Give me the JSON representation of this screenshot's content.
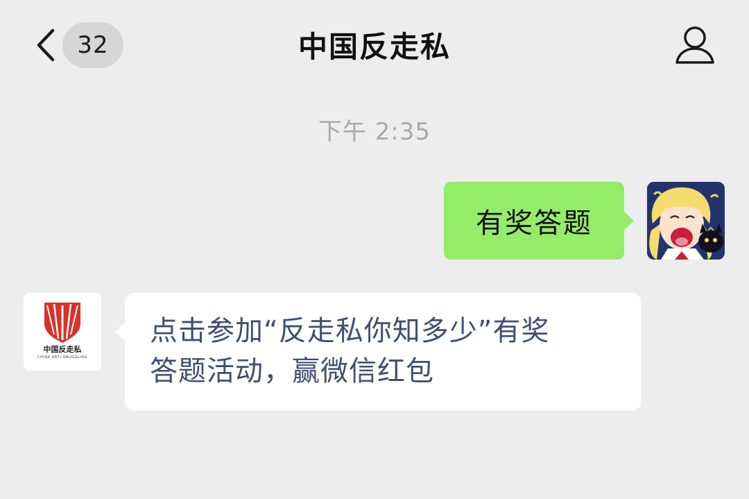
{
  "header": {
    "unread_count": "32",
    "title": "中国反走私"
  },
  "timestamp": "下午 2:35",
  "messages": [
    {
      "direction": "outgoing",
      "text": "有奖答题"
    },
    {
      "direction": "incoming",
      "lines": [
        "点击参加“反走私你知多少”有奖",
        "答题活动，赢微信红包"
      ]
    }
  ],
  "official_account": {
    "logo_text": "中国反走私",
    "logo_subtext": "CHINA ANTI-SMUGGLING"
  },
  "icons": {
    "back": "chevron-left-icon",
    "profile": "person-icon"
  },
  "colors": {
    "background": "#ededed",
    "outgoing_bubble": "#95ec69",
    "incoming_bubble": "#ffffff",
    "unread_badge": "#d6d6d6",
    "incoming_text": "#3e5070",
    "timestamp": "#a9a9a9",
    "logo_red": "#d9322b"
  }
}
